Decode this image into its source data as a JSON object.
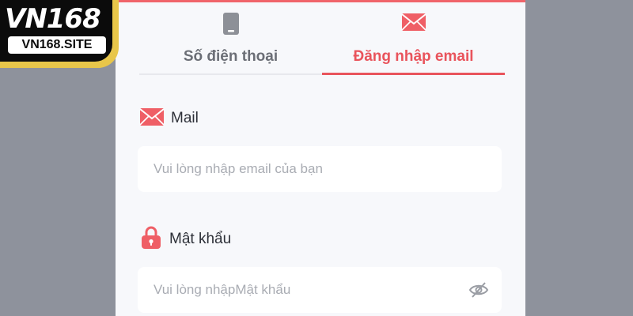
{
  "brand": {
    "logo_text": "VN168",
    "site": "VN168.SITE"
  },
  "tabs": [
    {
      "label": "Số điện thoại",
      "icon": "phone-icon",
      "active": false
    },
    {
      "label": "Đăng nhập email",
      "icon": "envelope-icon",
      "active": true
    }
  ],
  "form": {
    "mail_label": "Mail",
    "mail_placeholder": "Vui lòng nhập email của bạn",
    "password_label": "Mật khẩu",
    "password_placeholder": "Vui lòng nhậpMật khẩu"
  },
  "colors": {
    "accent": "#e9545c",
    "panel_bg": "#f7f8fb",
    "page_bg": "#8e929c",
    "logo_gold": "#e8c64a"
  }
}
